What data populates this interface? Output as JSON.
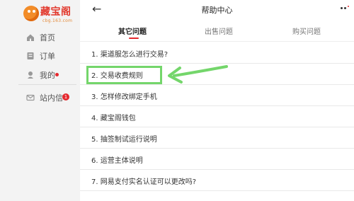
{
  "brand": {
    "name": "藏宝阁",
    "url": "cbg.163.com"
  },
  "sidebar": {
    "items": [
      {
        "label": "首页",
        "icon": "home-icon"
      },
      {
        "label": "订单",
        "icon": "order-icon"
      },
      {
        "label": "我的",
        "icon": "user-icon"
      }
    ],
    "inbox": {
      "label": "站内信",
      "icon": "mail-icon",
      "badge": "1"
    }
  },
  "header": {
    "title": "帮助中心"
  },
  "tabs": [
    {
      "label": "其它问题"
    },
    {
      "label": "出售问题"
    },
    {
      "label": "购买问题"
    }
  ],
  "questions": [
    "1. 渠道服怎么进行交易?",
    "2. 交易收费规则",
    "3. 怎样修改绑定手机",
    "4. 藏宝阁钱包",
    "5. 抽签制试运行说明",
    "6. 运营主体说明",
    "7. 网易支付实名认证可以更改吗?"
  ],
  "colors": {
    "accent": "#e5282d",
    "highlight": "#74d66b"
  }
}
